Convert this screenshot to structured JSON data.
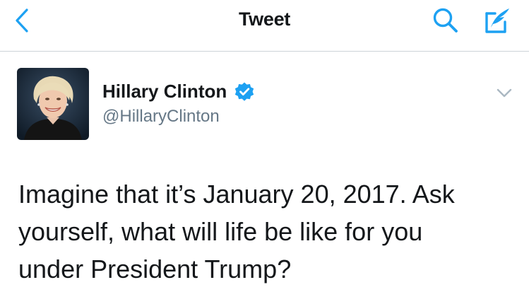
{
  "header": {
    "title": "Tweet",
    "back_icon": "chevron-left-icon",
    "search_icon": "search-icon",
    "compose_icon": "compose-tweet-icon"
  },
  "tweet": {
    "author": {
      "name": "Hillary Clinton",
      "handle": "@HillaryClinton",
      "verified": true,
      "avatar_icon": "avatar-photo"
    },
    "text": "Imagine that it’s January 20, 2017. Ask\nyourself, what will life be like for you\nunder President Trump?",
    "more_icon": "chevron-down-icon"
  },
  "colors": {
    "accent": "#1da1f2",
    "text": "#14171a",
    "secondary": "#657786",
    "divider": "#cdd3d8"
  }
}
